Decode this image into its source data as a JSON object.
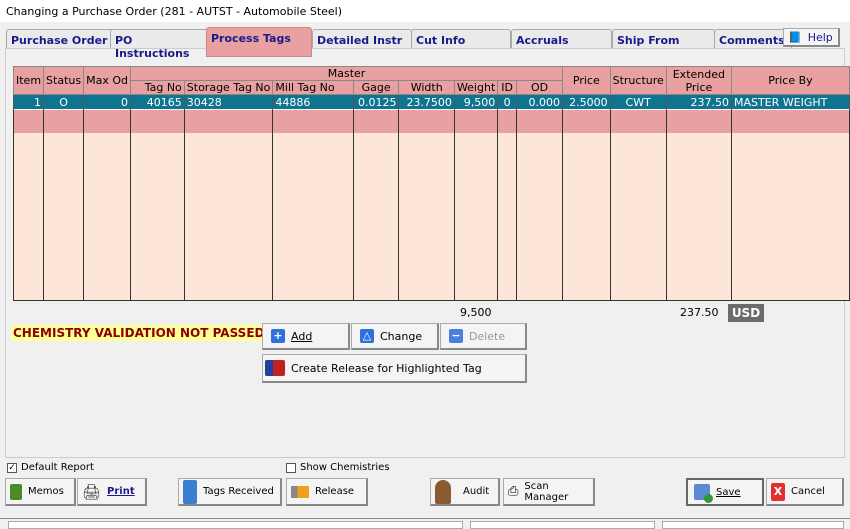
{
  "window": {
    "title": "Changing a Purchase Order  (281 - AUTST - Automobile Steel)"
  },
  "tabs": [
    "Purchase Order",
    "PO Instructions",
    "Process Tags",
    "Detailed Instr",
    "Cut Info",
    "Accruals",
    "Ship From",
    "Comments"
  ],
  "help_label": "Help",
  "grid": {
    "group_header": "Master",
    "columns": [
      "Item",
      "Status",
      "Max Od",
      "Tag No",
      "Storage Tag No",
      "Mill Tag No",
      "Gage",
      "Width",
      "Weight",
      "ID",
      "OD",
      "Price",
      "Structure",
      "Extended Price",
      "Price By"
    ],
    "rows": [
      {
        "item": "1",
        "status": "O",
        "max_od": "0",
        "tag_no": "40165",
        "storage_tag_no": "30428",
        "mill_tag_no": "44886",
        "gage": "0.0125",
        "width": "23.7500",
        "weight": "9,500",
        "id": "0",
        "od": "0.000",
        "price": "2.5000",
        "structure": "CWT",
        "extended_price": "237.50",
        "price_by": "MASTER WEIGHT"
      }
    ]
  },
  "totals": {
    "weight": "9,500",
    "extended_price": "237.50",
    "currency": "USD"
  },
  "warning": "CHEMISTRY VALIDATION NOT PASSED",
  "actions": {
    "add": "Add",
    "change": "Change",
    "delete": "Delete",
    "create_release": "Create Release for Highlighted Tag"
  },
  "options": {
    "default_report": "Default Report",
    "default_report_checked": true,
    "show_chemistries": "Show Chemistries",
    "show_chemistries_checked": false
  },
  "footer": {
    "memos": "Memos",
    "print": "Print",
    "tags_received": "Tags Received",
    "release": "Release",
    "audit": "Audit",
    "scan_manager": "Scan Manager",
    "save": "Save",
    "cancel": "Cancel"
  }
}
